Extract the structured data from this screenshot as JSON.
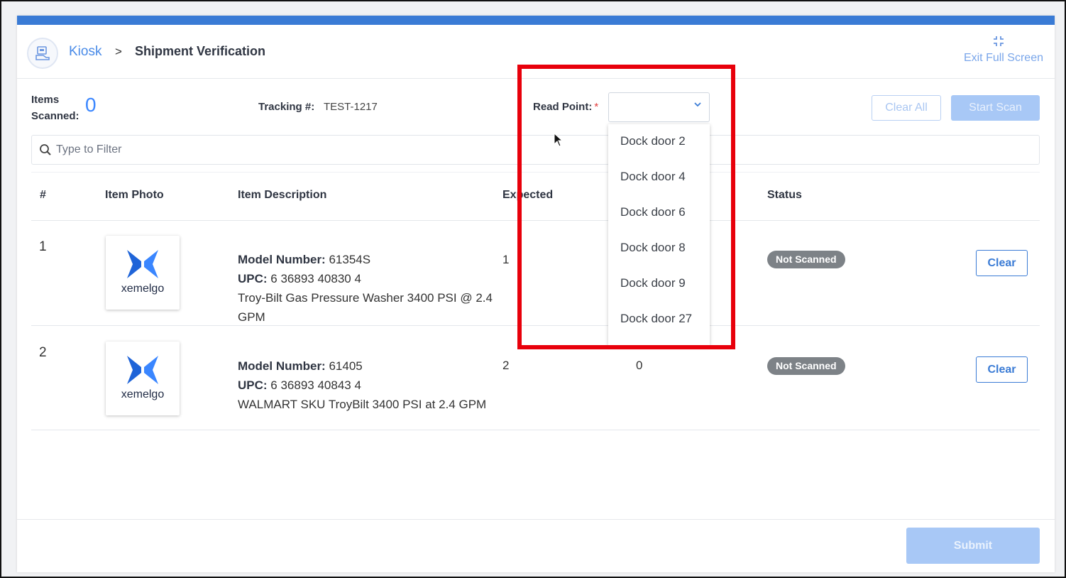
{
  "header": {
    "breadcrumb_root": "Kiosk",
    "breadcrumb_sep": ">",
    "breadcrumb_current": "Shipment Verification",
    "exit_fullscreen_label": "Exit Full Screen"
  },
  "info": {
    "items_scanned_label_line1": "Items",
    "items_scanned_label_line2": "Scanned:",
    "items_scanned_value": "0",
    "tracking_label": "Tracking #:",
    "tracking_value": "TEST-1217",
    "read_point_label": "Read Point:",
    "required_mark": "*",
    "clear_all_label": "Clear All",
    "start_scan_label": "Start Scan"
  },
  "filter": {
    "placeholder": "Type to Filter"
  },
  "table": {
    "headers": {
      "num": "#",
      "photo": "Item Photo",
      "description": "Item Description",
      "expected": "Expected",
      "status": "Status"
    },
    "rows": [
      {
        "num": "1",
        "brand": "xemelgo",
        "model_label": "Model Number:",
        "model_value": "61354S",
        "upc_label": "UPC:",
        "upc_value": "6 36893 40830 4",
        "name": "Troy-Bilt Gas Pressure Washer 3400 PSI @ 2.4 GPM",
        "expected": "1",
        "status": "Not Scanned",
        "action": "Clear"
      },
      {
        "num": "2",
        "brand": "xemelgo",
        "model_label": "Model Number:",
        "model_value": "61405",
        "upc_label": "UPC:",
        "upc_value": "6 36893 40843 4",
        "name": "WALMART SKU TroyBilt 3400 PSI at 2.4 GPM",
        "expected": "2",
        "scanned": "0",
        "status": "Not Scanned",
        "action": "Clear"
      }
    ]
  },
  "read_point_dropdown": {
    "options": [
      "Dock door 2",
      "Dock door 4",
      "Dock door 6",
      "Dock door 8",
      "Dock door 9",
      "Dock door 27"
    ]
  },
  "footer": {
    "submit_label": "Submit"
  },
  "colors": {
    "accent": "#3a7bd5",
    "link": "#4a8be8",
    "disabled_button": "#a8c8f6",
    "status_badge": "#7d8287",
    "highlight": "#e8000b"
  }
}
